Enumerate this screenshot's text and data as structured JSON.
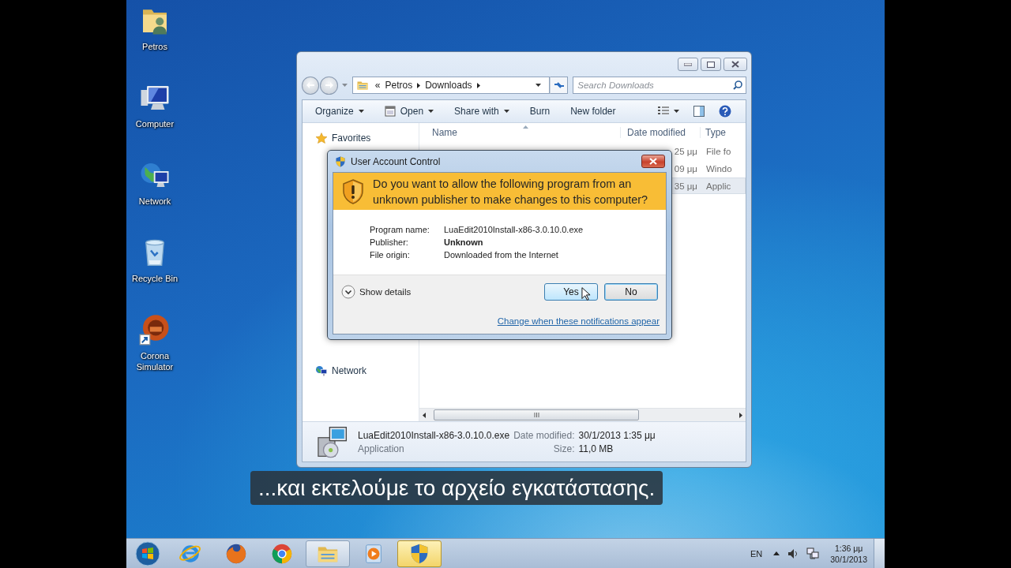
{
  "desktop_icons": [
    {
      "kind": "user-folder",
      "label": "Petros"
    },
    {
      "kind": "computer",
      "label": "Computer"
    },
    {
      "kind": "network",
      "label": "Network"
    },
    {
      "kind": "recycle-bin",
      "label": "Recycle Bin"
    },
    {
      "kind": "shortcut-app",
      "label": "Corona Simulator"
    }
  ],
  "explorer": {
    "address": {
      "overflow": "«",
      "crumbs": [
        "Petros",
        "Downloads"
      ]
    },
    "search": {
      "placeholder": "Search Downloads"
    },
    "toolbar": [
      {
        "label": "Organize",
        "icon": false,
        "dropdown": true
      },
      {
        "label": "Open",
        "icon": true,
        "dropdown": true
      },
      {
        "label": "Share with",
        "icon": false,
        "dropdown": true
      },
      {
        "label": "Burn",
        "icon": false,
        "dropdown": false
      },
      {
        "label": "New folder",
        "icon": false,
        "dropdown": false
      }
    ],
    "nav": [
      {
        "kind": "favorites",
        "label": "Favorites"
      },
      {
        "kind": "network",
        "label": "Network"
      }
    ],
    "columns": [
      "Name",
      "Date modified",
      "Type"
    ],
    "rows": [
      {
        "date": "25 μμ",
        "type": "File fo",
        "selected": false
      },
      {
        "date": "09 μμ",
        "type": "Windo",
        "selected": false
      },
      {
        "date": "35 μμ",
        "type": "Applic",
        "selected": true
      }
    ],
    "details": {
      "file_name": "LuaEdit2010Install-x86-3.0.10.0.exe",
      "file_type": "Application",
      "date_label": "Date modified:",
      "date": "30/1/2013 1:35 μμ",
      "size_label": "Size:",
      "size": "11,0 MB"
    }
  },
  "uac": {
    "title": "User Account Control",
    "question": "Do you want to allow the following program from an unknown publisher to make changes to this computer?",
    "fields": [
      {
        "label": "Program name:",
        "value": "LuaEdit2010Install-x86-3.0.10.0.exe",
        "bold": false
      },
      {
        "label": "Publisher:",
        "value": "Unknown",
        "bold": true
      },
      {
        "label": "File origin:",
        "value": "Downloaded from the Internet",
        "bold": false
      }
    ],
    "details_toggle": "Show details",
    "buttons": [
      {
        "label": "Yes",
        "hover": true
      },
      {
        "label": "No",
        "hover": false
      }
    ],
    "link": "Change when these notifications appear"
  },
  "subtitle": "...και εκτελούμε το αρχείο εγκατάστασης.",
  "taskbar": {
    "apps": [
      {
        "kind": "ie",
        "running": false,
        "flashing": false
      },
      {
        "kind": "firefox",
        "running": false,
        "flashing": false
      },
      {
        "kind": "chrome",
        "running": false,
        "flashing": false
      },
      {
        "kind": "explorer",
        "running": true,
        "flashing": false
      },
      {
        "kind": "media",
        "running": false,
        "flashing": false
      },
      {
        "kind": "uac",
        "running": true,
        "flashing": true
      }
    ],
    "language": "EN",
    "time": "1:36 μμ",
    "date": "30/1/2013"
  }
}
